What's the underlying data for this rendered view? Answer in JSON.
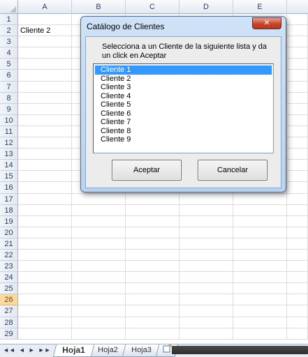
{
  "sheet": {
    "columns": [
      "A",
      "B",
      "C",
      "D",
      "E"
    ],
    "rows": [
      "1",
      "2",
      "3",
      "4",
      "5",
      "6",
      "7",
      "8",
      "9",
      "10",
      "11",
      "12",
      "13",
      "14",
      "15",
      "16",
      "17",
      "18",
      "19",
      "20",
      "21",
      "22",
      "23",
      "24",
      "25",
      "26",
      "27",
      "28",
      "29"
    ],
    "active_row": "26",
    "cell_A2": "Cliente 2"
  },
  "tabbar": {
    "nav": [
      "◄◄",
      "◄",
      "►",
      "►►"
    ],
    "tabs": [
      {
        "label": "Hoja1",
        "active": true
      },
      {
        "label": "Hoja2",
        "active": false
      },
      {
        "label": "Hoja3",
        "active": false
      }
    ],
    "new_tab_icon": "insert-sheet-icon"
  },
  "dialog": {
    "title": "Catálogo de Clientes",
    "close_icon": "close-icon",
    "close_glyph": "✕",
    "prompt": "Selecciona a un Cliente de la siguiente lista y da un click en Aceptar",
    "items": [
      "Cliente 1",
      "Cliente 2",
      "Cliente 3",
      "Cliente 4",
      "Cliente 5",
      "Cliente 6",
      "Cliente 7",
      "Cliente 8",
      "Cliente 9"
    ],
    "selected_index": 0,
    "ok_label": "Aceptar",
    "cancel_label": "Cancelar"
  },
  "colors": {
    "selection": "#3399ff",
    "close_button": "#c7432a",
    "active_row_header": "#f9d99f"
  }
}
